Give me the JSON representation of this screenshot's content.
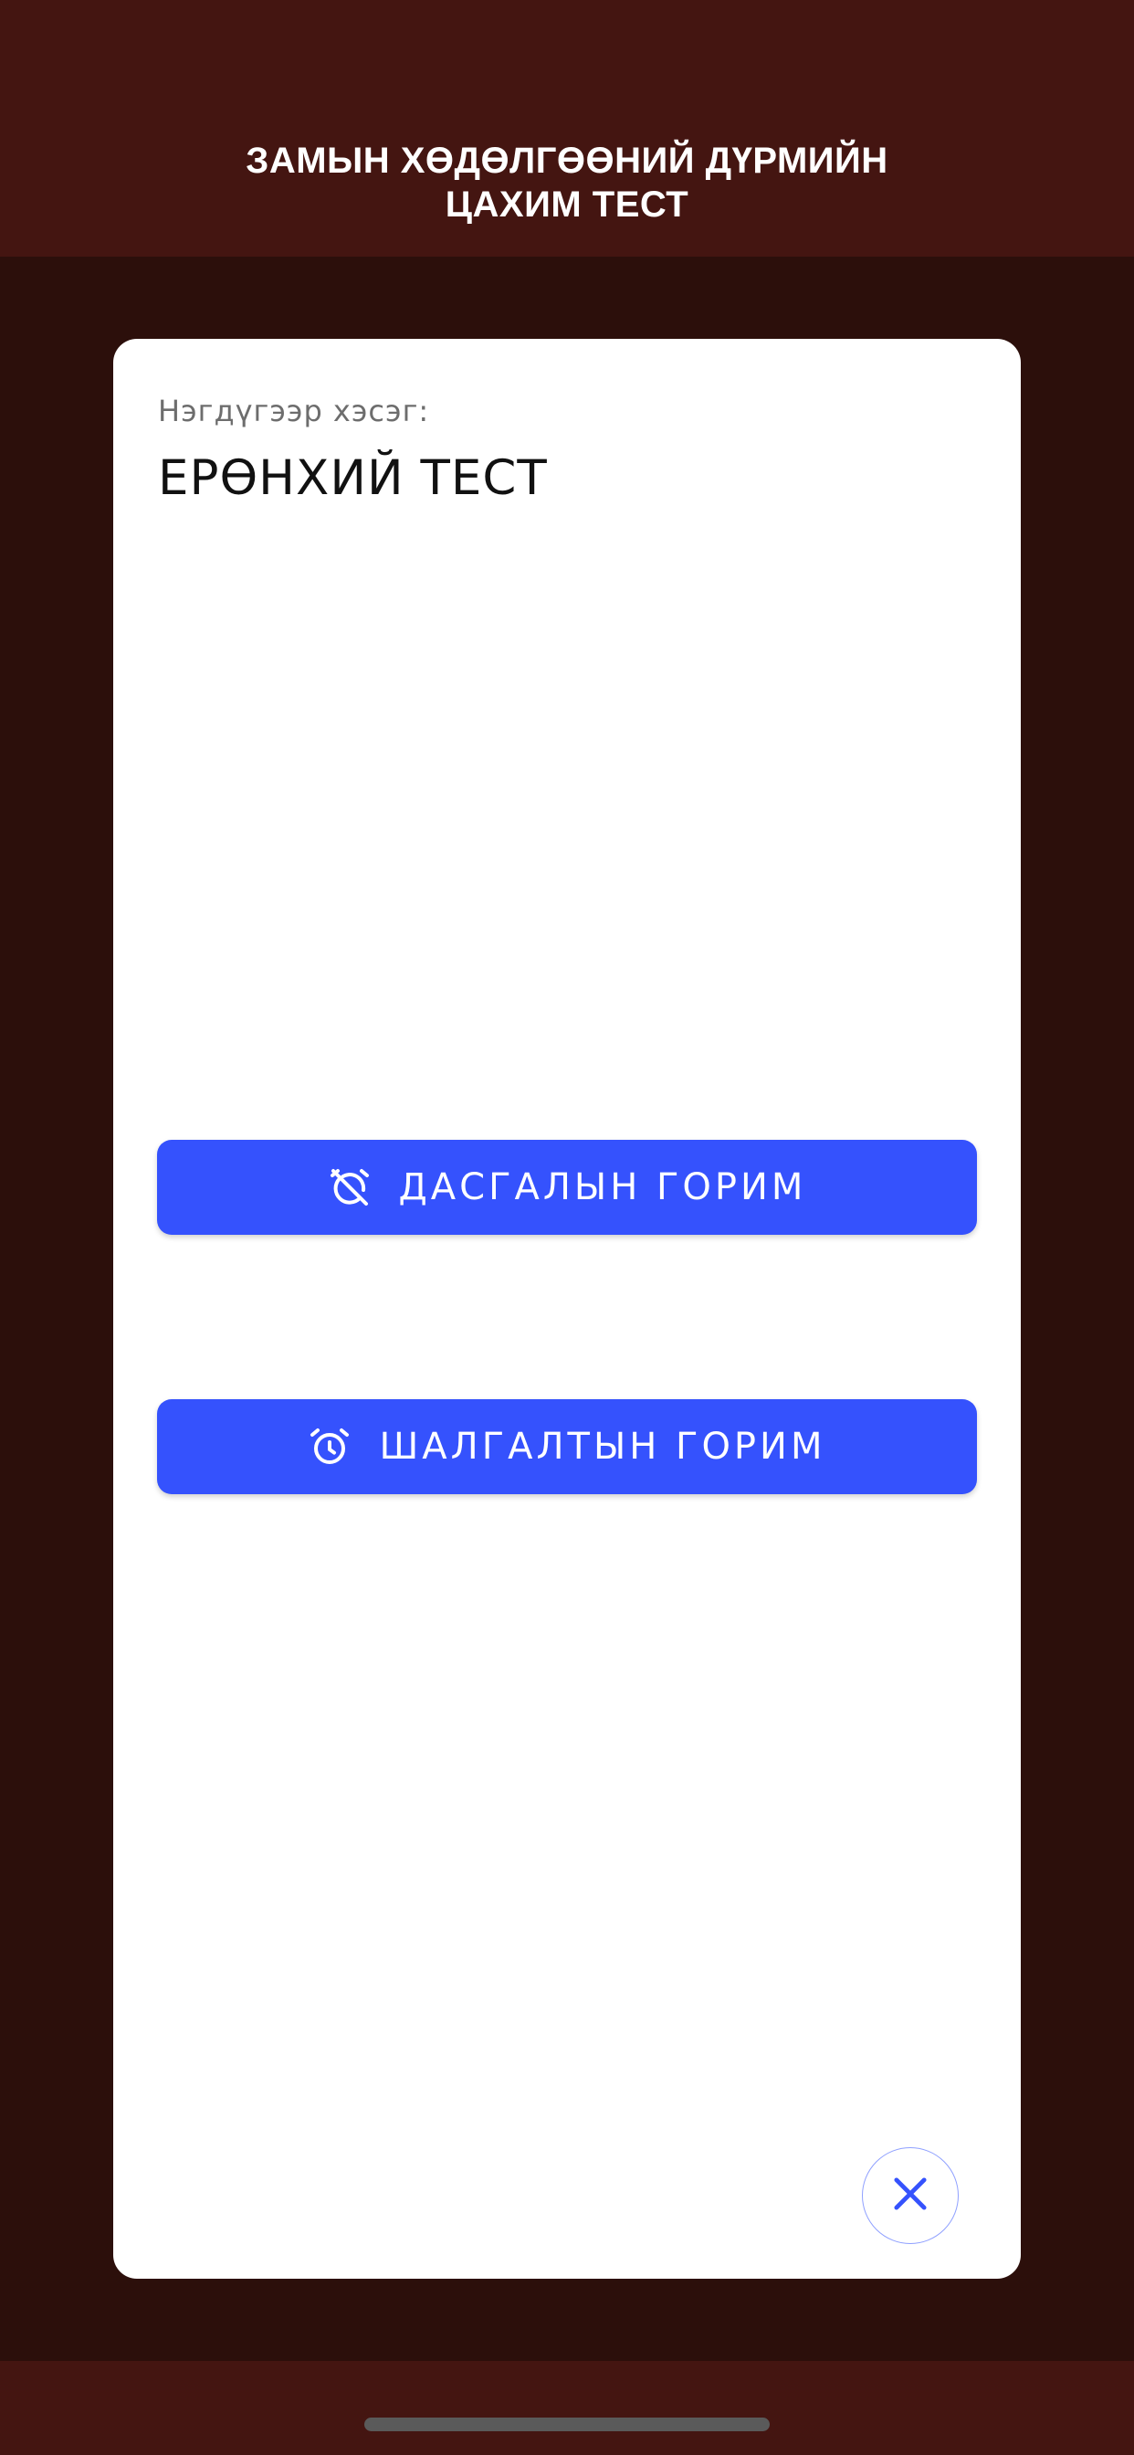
{
  "header": {
    "title_line1": "ЗАМЫН ХӨДӨЛГӨӨНИЙ ДҮРМИЙН",
    "title_line2": "ЦАХИМ ТЕСТ"
  },
  "card": {
    "section_label": "Нэгдүгээр хэсэг:",
    "section_title": "ЕРӨНХИЙ ТЕСТ",
    "practice_button": {
      "label": "ДАСГАЛЫН ГОРИМ",
      "icon": "alarm-off-icon"
    },
    "exam_button": {
      "label": "ШАЛГАЛТЫН ГОРИМ",
      "icon": "alarm-icon"
    },
    "close_button": {
      "icon": "close-icon"
    }
  },
  "colors": {
    "header_bg": "#441511",
    "page_bg": "#2c0f0b",
    "button_bg": "#3552fd",
    "close_icon": "#3552fd"
  }
}
